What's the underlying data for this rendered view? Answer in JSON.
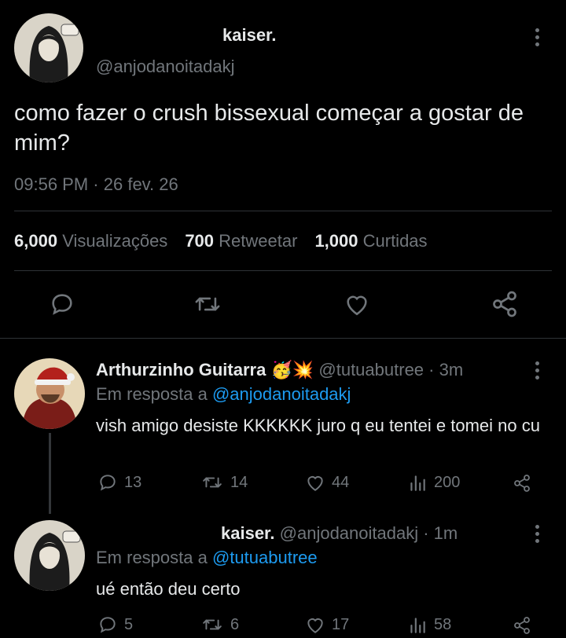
{
  "tweet": {
    "author_name": "kaiser.",
    "author_handle": "@anjodanoitadakj",
    "text": "como fazer o crush bissexual começar a gostar de mim?",
    "time": "09:56 PM",
    "date": "26 fev. 26",
    "separator": "·",
    "stats": {
      "views_count": "6,000",
      "views_label": "Visualizações",
      "retweets_count": "700",
      "retweets_label": "Retweetar",
      "likes_count": "1,000",
      "likes_label": "Curtidas"
    }
  },
  "replies": [
    {
      "author_name": "Arthurzinho Guitarra",
      "emoji": "🥳💥",
      "author_handle": "@tutuabutree",
      "time": "· 3m",
      "reply_prefix": "Em resposta a",
      "reply_to": "@anjodanoitadakj",
      "text": "vish amigo desiste KKKKKK juro q eu tentei e tomei no cu",
      "replies": "13",
      "retweets": "14",
      "likes": "44",
      "views": "200"
    },
    {
      "author_name": "kaiser.",
      "author_handle": "@anjodanoitadakj",
      "time": "· 1m",
      "reply_prefix": "Em resposta a",
      "reply_to": "@tutuabutree",
      "text": "ué então deu certo",
      "replies": "5",
      "retweets": "6",
      "likes": "17",
      "views": "58"
    }
  ],
  "colors": {
    "background": "#000000",
    "text": "#e7e9ea",
    "muted": "#71767b",
    "link": "#1d9bf0",
    "divider": "#2f3336"
  }
}
